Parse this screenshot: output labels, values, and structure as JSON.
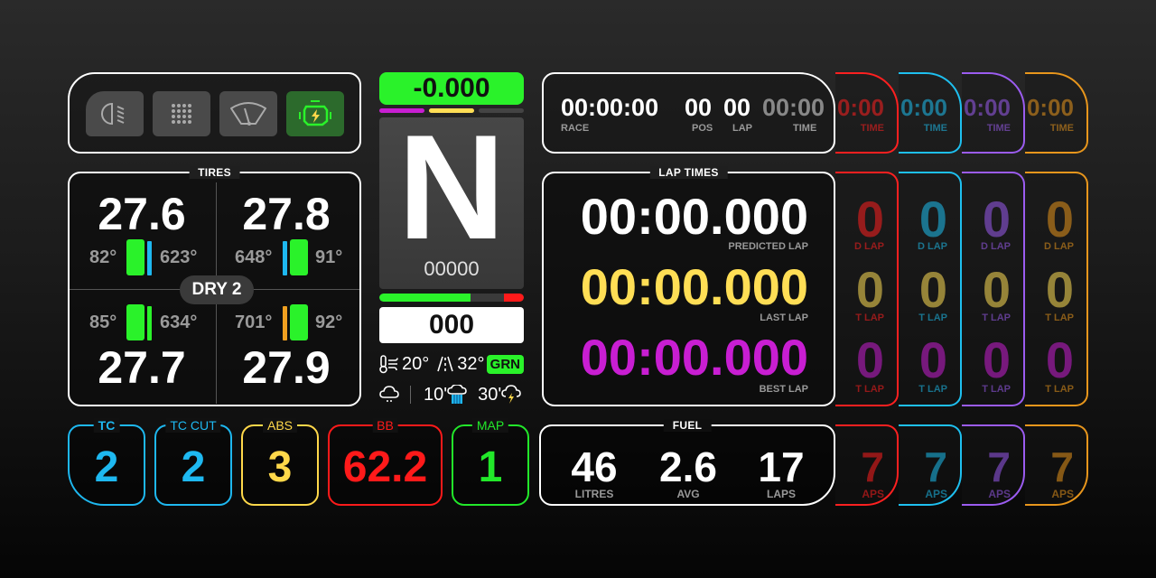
{
  "status_lights": [
    {
      "name": "headlights",
      "icon": "headlight-icon",
      "active": false
    },
    {
      "name": "rain-lights",
      "icon": "dot-grid-icon",
      "active": false
    },
    {
      "name": "wipers",
      "icon": "wiper-icon",
      "active": false
    },
    {
      "name": "engine",
      "icon": "engine-icon",
      "active": true
    }
  ],
  "tires": {
    "title": "TIRES",
    "compound": "DRY 2",
    "front_left": {
      "psi": "27.6",
      "inner_temp": "82°",
      "brake_temp": "623°"
    },
    "front_right": {
      "psi": "27.8",
      "brake_temp": "648°",
      "inner_temp": "91°"
    },
    "rear_left": {
      "psi": "27.7",
      "inner_temp": "85°",
      "brake_temp": "634°"
    },
    "rear_right": {
      "psi": "27.9",
      "brake_temp": "701°",
      "inner_temp": "92°"
    }
  },
  "gear_panel": {
    "delta": "-0.000",
    "gear": "N",
    "rpm": "00000",
    "speed": "000",
    "rpm_fraction": 0.63,
    "air_temp": "20°",
    "track_temp": "32°",
    "flag": "GRN",
    "forecast": [
      {
        "time": "",
        "icon": "cloud-drizzle-icon"
      },
      {
        "time": "10'",
        "icon": "cloud-rain-icon"
      },
      {
        "time": "30'",
        "icon": "cloud-lightning-icon"
      }
    ]
  },
  "race_info": {
    "race_time": "00:00:00",
    "race_label": "RACE",
    "pos": "00",
    "pos_label": "POS",
    "lap": "00",
    "lap_label": "LAP",
    "time": "00:00",
    "time_label": "TIME"
  },
  "lap_times": {
    "title": "LAP TIMES",
    "predicted": {
      "value": "00:00.000",
      "label": "PREDICTED LAP"
    },
    "last": {
      "value": "00:00.000",
      "label": "LAST LAP"
    },
    "best": {
      "value": "00:00.000",
      "label": "BEST LAP"
    }
  },
  "aids": [
    {
      "label": "TC",
      "value": "2",
      "color": "#1eb8f0"
    },
    {
      "label": "TC CUT",
      "value": "2",
      "color": "#1eb8f0"
    },
    {
      "label": "ABS",
      "value": "3",
      "color": "#ffd84a"
    },
    {
      "label": "BB",
      "value": "62.2",
      "color": "#ff1a1a"
    },
    {
      "label": "MAP",
      "value": "1",
      "color": "#22e82a"
    }
  ],
  "fuel": {
    "title": "FUEL",
    "litres": "46",
    "litres_label": "LITRES",
    "avg": "2.6",
    "avg_label": "AVG",
    "laps": "17",
    "laps_label": "LAPS"
  },
  "ghosts": {
    "colors": [
      "#ff2020",
      "#1ec0f0",
      "#9b5cf0",
      "#e8961c"
    ],
    "time_fragment": "0:00",
    "time_label": "TIME",
    "lap_digit": "0",
    "pred_label": "D LAP",
    "last_label": "T LAP",
    "best_label": "T LAP",
    "fuel_digit": "7",
    "fuel_label": "APS"
  },
  "colors": {
    "green": "#2af22a",
    "yellow": "#ffde55",
    "magenta": "#c81ed2",
    "blue": "#1eb8f0",
    "orange": "#f0a020"
  }
}
